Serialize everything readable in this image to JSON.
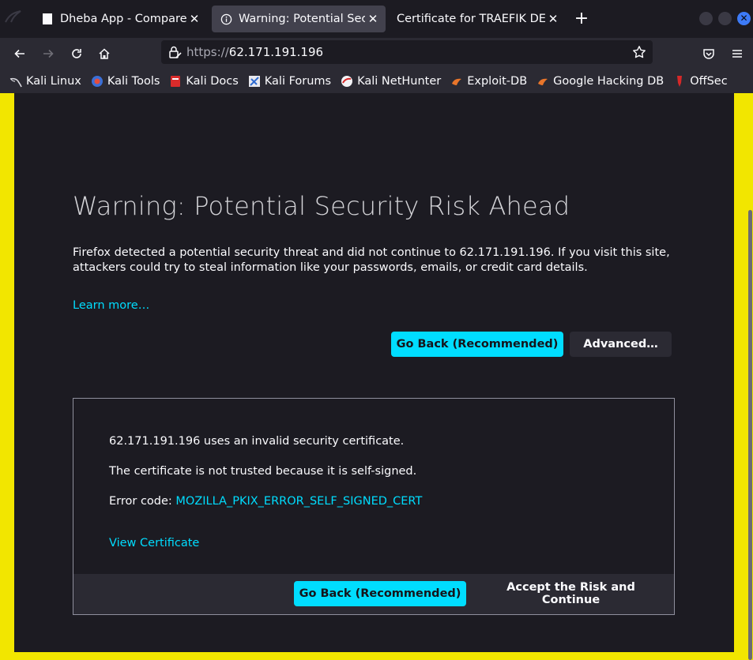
{
  "tabs": [
    {
      "label": "Dheba App - Compare Pri",
      "icon": "page-icon",
      "active": false
    },
    {
      "label": "Warning: Potential Securi",
      "icon": "info-icon",
      "active": true
    },
    {
      "label": "Certificate for TRAEFIK DEFA",
      "icon": "",
      "active": false
    }
  ],
  "nav": {
    "url_scheme": "https://",
    "url_host": "62.171.191.196"
  },
  "bookmarks": [
    {
      "label": "Kali Linux",
      "icon": "kali-dragon-icon"
    },
    {
      "label": "Kali Tools",
      "icon": "kali-tools-icon"
    },
    {
      "label": "Kali Docs",
      "icon": "kali-docs-icon"
    },
    {
      "label": "Kali Forums",
      "icon": "kali-forums-icon"
    },
    {
      "label": "Kali NetHunter",
      "icon": "nethunter-icon"
    },
    {
      "label": "Exploit-DB",
      "icon": "exploit-db-icon"
    },
    {
      "label": "Google Hacking DB",
      "icon": "ghdb-icon"
    },
    {
      "label": "OffSec",
      "icon": "offsec-icon"
    }
  ],
  "warning": {
    "title": "Warning: Potential Security Risk Ahead",
    "intro": "Firefox detected a potential security threat and did not continue to 62.171.191.196. If you visit this site, attackers could try to steal information like your passwords, emails, or credit card details.",
    "learn_more": "Learn more…",
    "go_back": "Go Back (Recommended)",
    "advanced": "Advanced…"
  },
  "advanced_panel": {
    "line1": "62.171.191.196 uses an invalid security certificate.",
    "line2": "The certificate is not trusted because it is self-signed.",
    "error_prefix": "Error code: ",
    "error_code": "MOZILLA_PKIX_ERROR_SELF_SIGNED_CERT",
    "view_certificate": "View Certificate",
    "go_back": "Go Back (Recommended)",
    "accept": "Accept the Risk and Continue"
  },
  "colors": {
    "accent": "#00ddff",
    "page_bg": "#1c1b22",
    "toolbar_bg": "#2b2a33",
    "frame_border": "#f2e600"
  }
}
